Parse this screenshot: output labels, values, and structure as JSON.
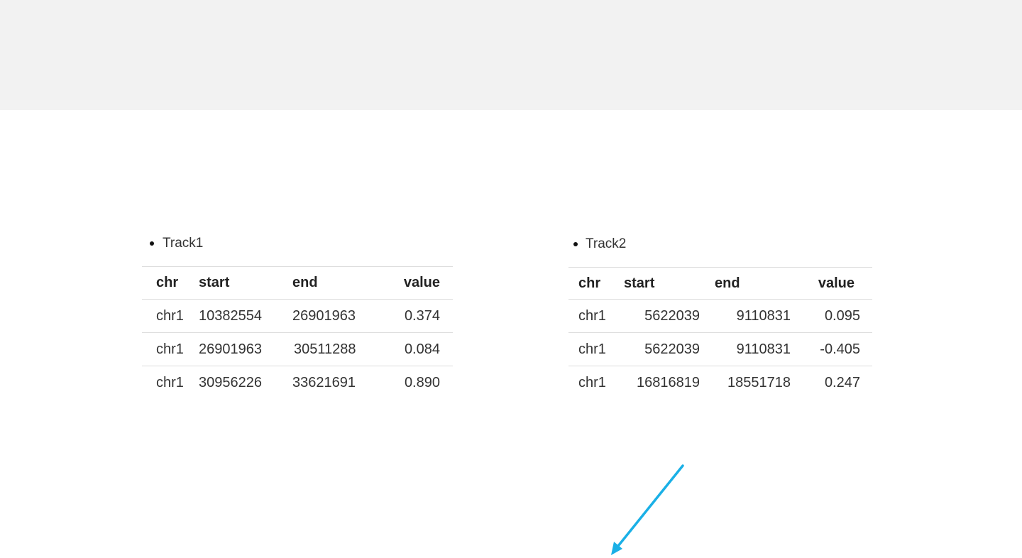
{
  "track1": {
    "label": "Track1",
    "columns": [
      "chr",
      "start",
      "end",
      "value"
    ],
    "rows": [
      [
        "chr1",
        "10382554",
        "26901963",
        "0.374"
      ],
      [
        "chr1",
        "26901963",
        "30511288",
        "0.084"
      ],
      [
        "chr1",
        "30956226",
        "33621691",
        "0.890"
      ]
    ]
  },
  "track2": {
    "label": "Track2",
    "columns": [
      "chr",
      "start",
      "end",
      "value"
    ],
    "rows": [
      [
        "chr1",
        "5622039",
        "9110831",
        "0.095"
      ],
      [
        "chr1",
        "5622039",
        "9110831",
        "-0.405"
      ],
      [
        "chr1",
        "16816819",
        "18551718",
        "0.247"
      ]
    ]
  },
  "annotation": {
    "arrow_color": "#1ab0e6",
    "arrow_icon": "arrow-down-left-icon"
  },
  "colors": {
    "header_band": "#f2f2f2",
    "rule": "#dddddd"
  }
}
